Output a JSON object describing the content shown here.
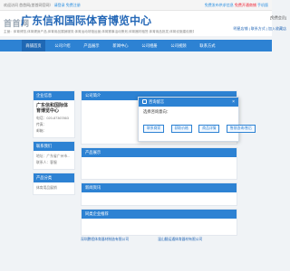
{
  "topbar": {
    "left_prefix": "欢迎访问",
    "left_site": "首首网(首首网官网）",
    "left_login": "请登录",
    "left_register": "免费注册",
    "right_text": "免费发布供求信息",
    "right_red": "免费开通商铺",
    "right_tail": "手机版"
  },
  "header": {
    "logo": "首首网",
    "company": "广东信和国际体育博览中心",
    "address": "主营：体育博览,体育健身产品,体育用品展销服务,体育运动场馆运营,体育赛事活动策划,体育器材租赁,体育用品批发,体育设施建设服务",
    "status": "[免费会员]",
    "links": "明星店铺 | 联系方式 | 加入收藏店"
  },
  "nav": {
    "items": [
      "商铺首页",
      "公司介绍",
      "产品展示",
      "新闻中心",
      "公司相册",
      "公司视频",
      "联系方式"
    ]
  },
  "sidebar": {
    "info_title": "企业信息",
    "company_name": "广东信和国际体育博览中心",
    "phone": "电话：020-87367863",
    "fax": "传真：",
    "email": "邮箱：",
    "contact_title": "联系我们",
    "contact_lines": [
      "地址：广东省广州市...",
      "联系人：客服"
    ],
    "products_title": "产品分类",
    "products_items": [
      "体育用品展销"
    ]
  },
  "main": {
    "panel1_title": "公司简介",
    "panel2_title": "产品展示",
    "panel3_title": "新闻资讯",
    "panel4_title": "同类企业推荐"
  },
  "popup": {
    "title": "咨询留言",
    "close": "×",
    "label": "选择咨询意向：",
    "options": [
      "联系商家",
      "获取价格",
      "商品详情",
      "售前咨询/售后"
    ]
  },
  "footer": {
    "left_company": "深圳鹏程体育器材制造有限公司",
    "right_company": "温山翻运通体育器材有限公司"
  }
}
